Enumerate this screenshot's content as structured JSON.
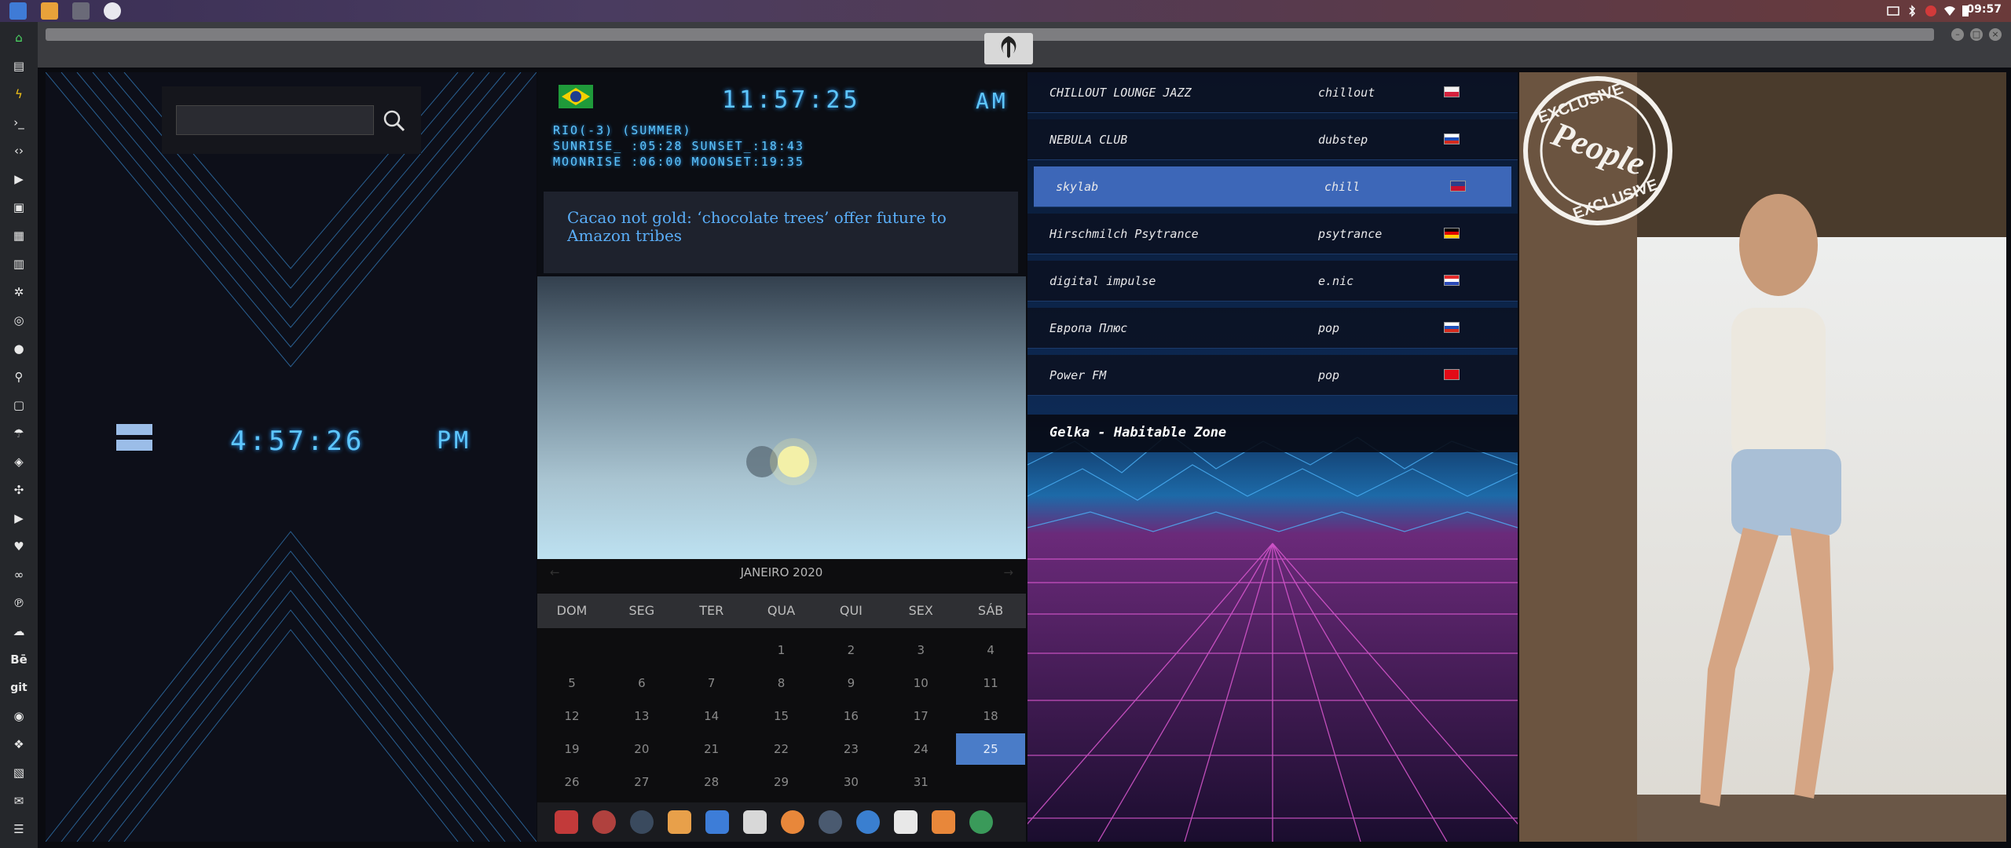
{
  "system": {
    "clock": "09:57"
  },
  "panel_clock": {
    "time": "4:57:26",
    "ampm": "PM"
  },
  "weather_clock": {
    "time": "11:57:25",
    "ampm": "AM",
    "location": "RIO(-3) (SUMMER)",
    "sun": "SUNRISE_ :05:28 SUNSET_:18:43",
    "moon": "MOONRISE :06:00 MOONSET:19:35"
  },
  "news": {
    "headline": "Cacao not gold: ‘chocolate trees’ offer future to Amazon tribes"
  },
  "calendar": {
    "title": "JANEIRO 2020",
    "weekdays": [
      "DOM",
      "SEG",
      "TER",
      "QUA",
      "QUI",
      "SEX",
      "SÁB"
    ],
    "weeks": [
      [
        "",
        "",
        "",
        "1",
        "2",
        "3",
        "4"
      ],
      [
        "5",
        "6",
        "7",
        "8",
        "9",
        "10",
        "11"
      ],
      [
        "12",
        "13",
        "14",
        "15",
        "16",
        "17",
        "18"
      ],
      [
        "19",
        "20",
        "21",
        "22",
        "23",
        "24",
        "25"
      ],
      [
        "26",
        "27",
        "28",
        "29",
        "30",
        "31",
        ""
      ]
    ],
    "selected_day": "25"
  },
  "radio": {
    "stations": [
      {
        "name": "CHILLOUT LOUNGE JAZZ",
        "genre": "chillout",
        "flag": "poland-flag"
      },
      {
        "name": "NEBULA CLUB",
        "genre": "dubstep",
        "flag": "russia-flag"
      },
      {
        "name": "skylab",
        "genre": "chill",
        "flag": "uk-flag",
        "selected": true
      },
      {
        "name": "Hirschmilch Psytrance",
        "genre": "psytrance",
        "flag": "germany-flag"
      },
      {
        "name": "digital impulse",
        "genre": "e.nic",
        "flag": "croatia-flag"
      },
      {
        "name": "Европа Плюс",
        "genre": "pop",
        "flag": "russia-flag"
      },
      {
        "name": "Power FM",
        "genre": "pop",
        "flag": "turkey-flag"
      }
    ],
    "now_playing": "Gelka - Habitable Zone"
  },
  "photo": {
    "badge_top": "EXCLUSIVE",
    "badge_brand": "People",
    "badge_bottom": "EXCLUSIVE"
  },
  "colors": {
    "accent": "#5ec6ff",
    "selected": "#3d67b8",
    "calendar_selected": "#4a7cc8"
  }
}
